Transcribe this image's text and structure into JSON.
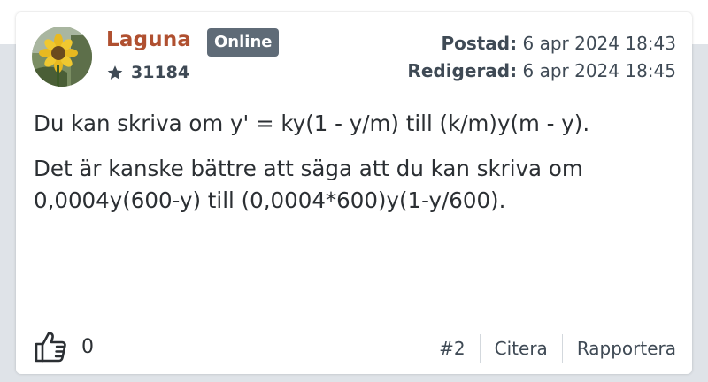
{
  "post": {
    "author": {
      "name": "Laguna",
      "status_badge": "Online",
      "score": "31184",
      "avatar_icon": "sunflower-avatar"
    },
    "meta": {
      "posted_label": "Postad:",
      "posted_value": "6 apr 2024 18:43",
      "edited_label": "Redigerad:",
      "edited_value": "6 apr 2024 18:45"
    },
    "body": {
      "paragraphs": [
        "Du kan skriva om y' = ky(1 - y/m) till (k/m)y(m - y).",
        "Det är kanske bättre att säga att du kan skriva om 0,0004y(600-y) till (0,0004*600)y(1-y/600)."
      ]
    },
    "footer": {
      "like_count": "0",
      "post_number": "#2",
      "quote_label": "Citera",
      "report_label": "Rapportera"
    }
  },
  "colors": {
    "username": "#b05030",
    "badge_bg": "#5f6b77",
    "text": "#2b2f33",
    "muted": "#3f4a55"
  }
}
